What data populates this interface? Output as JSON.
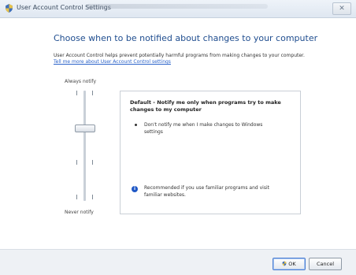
{
  "window": {
    "title": "User Account Control Settings",
    "close_glyph": "✕"
  },
  "main": {
    "heading": "Choose when to be notified about changes to your computer",
    "description": "User Account Control helps prevent potentially harmful programs from making changes to your computer.",
    "learn_more_link": "Tell me more about User Account Control settings"
  },
  "slider": {
    "label_top": "Always notify",
    "label_bottom": "Never notify",
    "level": 3,
    "levels_total": 4
  },
  "info_box": {
    "title": "Default - Notify me only when programs try to make changes to my computer",
    "bullet": "Don't notify me when I make changes to Windows settings",
    "recommendation": "Recommended if you use familiar programs and visit familiar websites."
  },
  "buttons": {
    "ok_label": "OK",
    "cancel_label": "Cancel"
  },
  "icons": {
    "title": "uac-shield-icon",
    "ok": "uac-shield-icon",
    "recommendation": "info-icon"
  },
  "colors": {
    "heading": "#1f4d8f",
    "link": "#2a62c9",
    "info_icon": "#1f58c6"
  }
}
